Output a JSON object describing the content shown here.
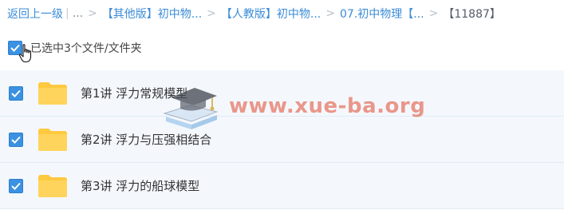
{
  "breadcrumb": {
    "back_label": "返回上一级",
    "pipe": "|",
    "ellipsis": "...",
    "separator": ">",
    "items": [
      "【其他版】初中物...",
      "【人教版】初中物...",
      "07.初中物理【..."
    ],
    "last": "【11887】"
  },
  "selection": {
    "label": "已选中3个文件/文件夹",
    "checked": true
  },
  "files": [
    {
      "name": "第1讲 浮力常规模型",
      "checked": true,
      "icon": "folder-icon"
    },
    {
      "name": "第2讲 浮力与压强相结合",
      "checked": true,
      "icon": "folder-icon"
    },
    {
      "name": "第3讲 浮力的船球模型",
      "checked": true,
      "icon": "folder-icon"
    }
  ],
  "watermark": {
    "text": "www.xue-ba.org",
    "color": "#e25c44"
  },
  "colors": {
    "accent": "#3b91e2",
    "link": "#3b8cd8",
    "row_bg": "#f4f8fd",
    "folder": "#ffd45c"
  }
}
